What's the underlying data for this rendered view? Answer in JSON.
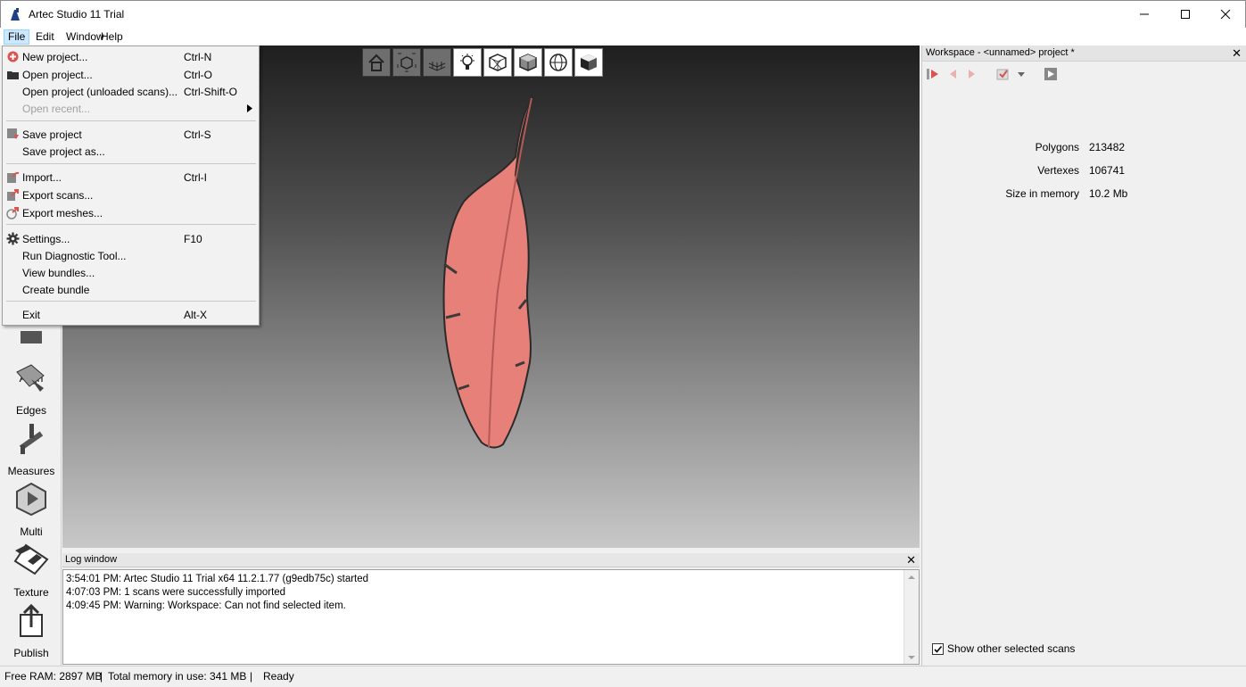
{
  "window": {
    "title": "Artec Studio 11 Trial"
  },
  "menubar": [
    "File",
    "Edit",
    "Window",
    "Help"
  ],
  "file_menu": [
    {
      "label": "New project...",
      "shortcut": "Ctrl-N",
      "icon": "new-project-icon"
    },
    {
      "label": "Open project...",
      "shortcut": "Ctrl-O",
      "icon": "folder-icon"
    },
    {
      "label": "Open project (unloaded scans)...",
      "shortcut": "Ctrl-Shift-O"
    },
    {
      "label": "Open recent...",
      "shortcut": "",
      "disabled": true,
      "submenu": true
    },
    {
      "label": "Save project",
      "shortcut": "Ctrl-S",
      "icon": "save-icon"
    },
    {
      "label": "Save project as...",
      "shortcut": ""
    },
    {
      "label": "Import...",
      "shortcut": "Ctrl-I",
      "icon": "import-icon"
    },
    {
      "label": "Export scans...",
      "shortcut": "",
      "icon": "export-scans-icon"
    },
    {
      "label": "Export meshes...",
      "shortcut": "",
      "icon": "export-meshes-icon"
    },
    {
      "label": "Settings...",
      "shortcut": "F10",
      "icon": "gear-icon"
    },
    {
      "label": "Run Diagnostic Tool...",
      "shortcut": ""
    },
    {
      "label": "View bundles...",
      "shortcut": ""
    },
    {
      "label": "Create bundle",
      "shortcut": ""
    },
    {
      "label": "Exit",
      "shortcut": "Alt-X"
    }
  ],
  "left_tools": [
    "Align",
    "Edges",
    "Measures",
    "Multi",
    "Texture",
    "Publish"
  ],
  "log": {
    "title": "Log window",
    "lines": [
      "3:54:01 PM: Artec Studio 11 Trial x64 11.2.1.77 (g9edb75c) started",
      "4:07:03 PM: 1 scans were successfully imported",
      "4:09:45 PM: Warning: Workspace: Can not find selected item."
    ]
  },
  "workspace": {
    "title": "Workspace - <unnamed> project *",
    "stats": [
      {
        "label": "Polygons",
        "value": "213482"
      },
      {
        "label": "Vertexes",
        "value": "106741"
      },
      {
        "label": "Size in memory",
        "value": "10.2 Mb"
      }
    ],
    "show_other": "Show other selected scans",
    "show_other_checked": true
  },
  "status": {
    "free_ram": "Free RAM: 2897 MB",
    "total_mem": "Total memory in use: 341 MB",
    "state": "Ready"
  },
  "colors": {
    "feather": "#e8807a",
    "menu_highlight": "#cce8ff"
  }
}
